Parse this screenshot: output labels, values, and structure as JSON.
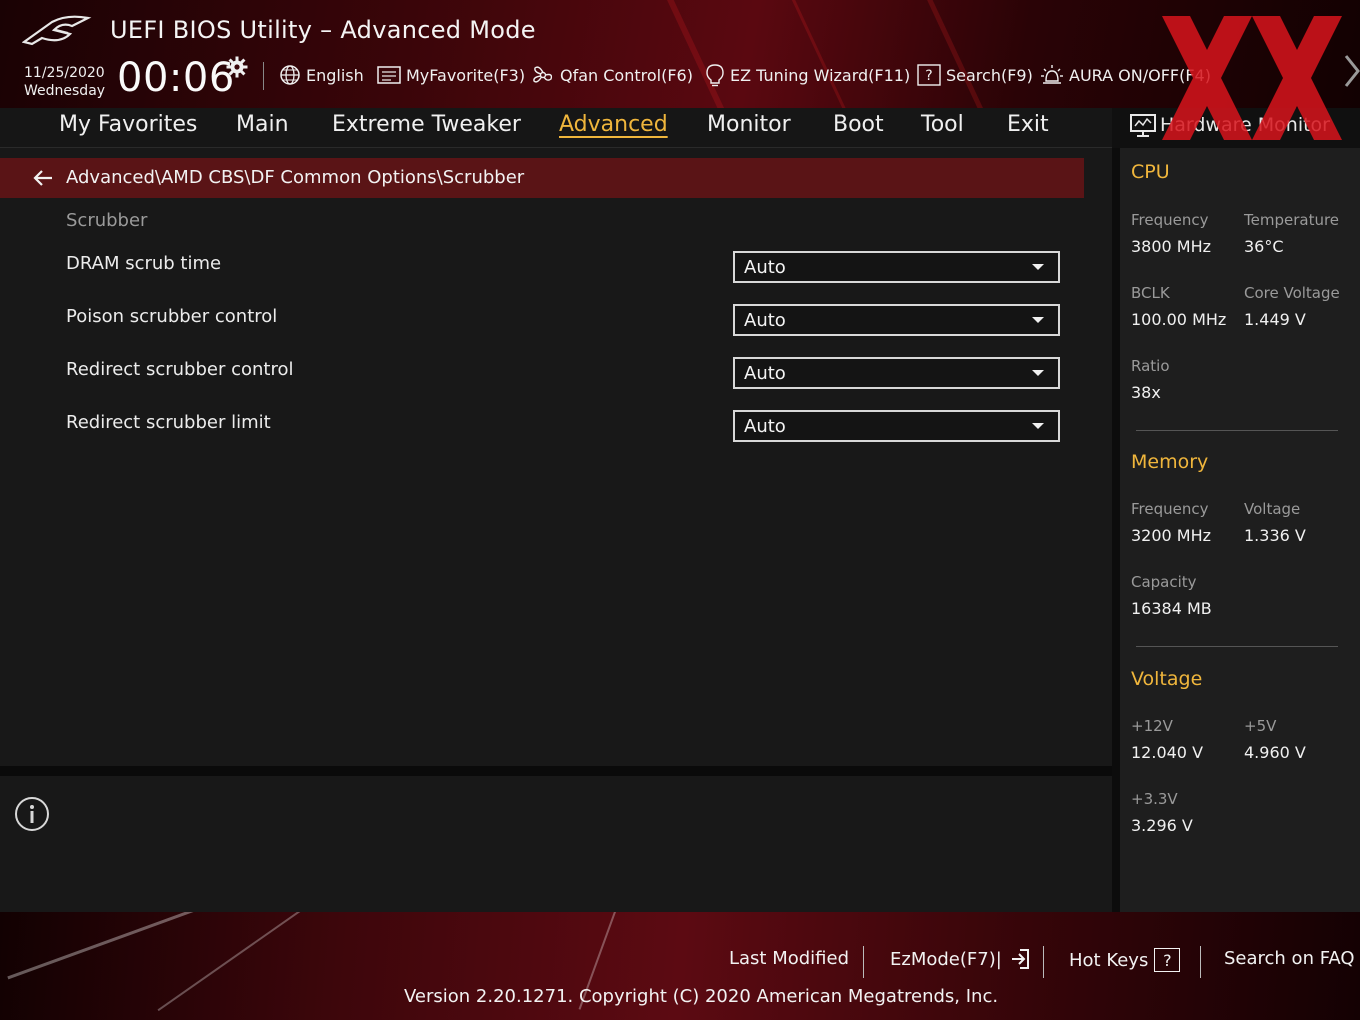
{
  "header": {
    "title": "UEFI BIOS Utility – Advanced Mode",
    "date": "11/25/2020",
    "day": "Wednesday",
    "time": "00:06",
    "toolbar": {
      "language": "English",
      "my_favorite": "MyFavorite(F3)",
      "qfan": "Qfan Control(F6)",
      "ez_tuning": "EZ Tuning Wizard(F11)",
      "search": "Search(F9)",
      "aura": "AURA ON/OFF(F4)"
    }
  },
  "tabs": [
    {
      "label": "My Favorites"
    },
    {
      "label": "Main"
    },
    {
      "label": "Extreme Tweaker"
    },
    {
      "label": "Advanced",
      "active": true
    },
    {
      "label": "Monitor"
    },
    {
      "label": "Boot"
    },
    {
      "label": "Tool"
    },
    {
      "label": "Exit"
    }
  ],
  "breadcrumb": "Advanced\\AMD CBS\\DF Common Options\\Scrubber",
  "section_label": "Scrubber",
  "settings": [
    {
      "label": "DRAM scrub time",
      "value": "Auto"
    },
    {
      "label": "Poison scrubber control",
      "value": "Auto"
    },
    {
      "label": "Redirect scrubber control",
      "value": "Auto"
    },
    {
      "label": "Redirect scrubber limit",
      "value": "Auto"
    }
  ],
  "hardware_monitor": {
    "title": "Hardware Monitor",
    "cpu": {
      "section": "CPU",
      "frequency_label": "Frequency",
      "frequency_value": "3800 MHz",
      "temperature_label": "Temperature",
      "temperature_value": "36°C",
      "bclk_label": "BCLK",
      "bclk_value": "100.00 MHz",
      "core_voltage_label": "Core Voltage",
      "core_voltage_value": "1.449 V",
      "ratio_label": "Ratio",
      "ratio_value": "38x"
    },
    "memory": {
      "section": "Memory",
      "frequency_label": "Frequency",
      "frequency_value": "3200 MHz",
      "voltage_label": "Voltage",
      "voltage_value": "1.336 V",
      "capacity_label": "Capacity",
      "capacity_value": "16384 MB"
    },
    "voltage": {
      "section": "Voltage",
      "v12_label": "+12V",
      "v12_value": "12.040 V",
      "v5_label": "+5V",
      "v5_value": "4.960 V",
      "v33_label": "+3.3V",
      "v33_value": "3.296 V"
    }
  },
  "footer": {
    "last_modified": "Last Modified",
    "ezmode": "EzMode(F7)|",
    "hot_keys": "Hot Keys",
    "hot_keys_key": "?",
    "search_faq": "Search on FAQ",
    "version": "Version 2.20.1271. Copyright (C) 2020 American Megatrends, Inc."
  },
  "colors": {
    "accent": "#f0b63c",
    "breadcrumb_bg": "#5a1416",
    "brand_red": "#d8141c"
  }
}
